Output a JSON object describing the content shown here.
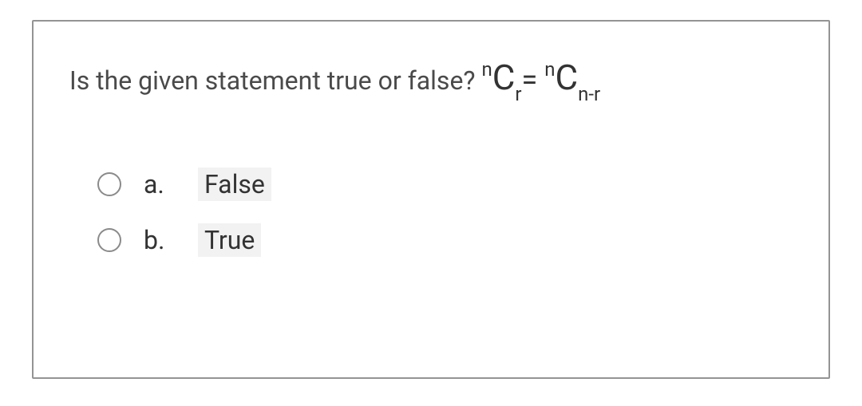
{
  "question": {
    "prompt": "Is the given statement true or false? ",
    "formula": {
      "pre1": "n",
      "c1": "C",
      "sub1": "r",
      "eq": "= ",
      "pre2": "n",
      "c2": "C",
      "sub2": "n-r"
    }
  },
  "options": [
    {
      "letter": "a.",
      "text": "False"
    },
    {
      "letter": "b.",
      "text": "True"
    }
  ]
}
